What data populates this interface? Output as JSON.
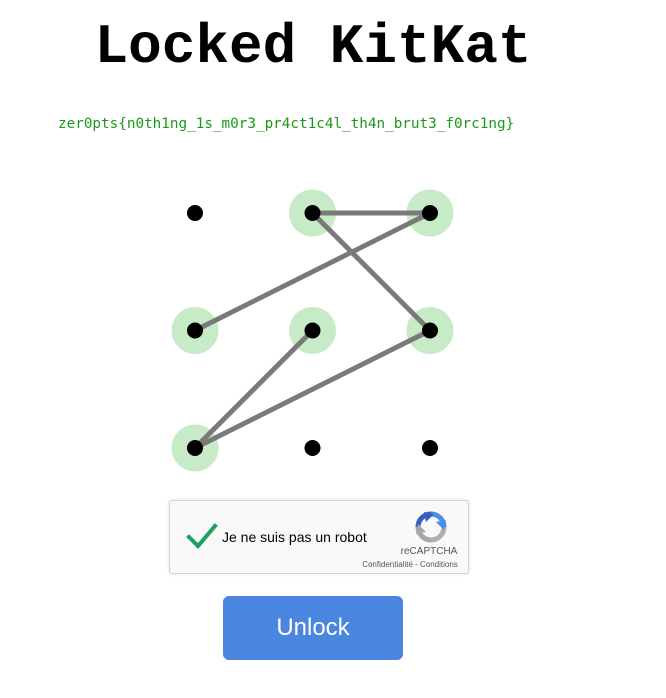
{
  "title": "Locked KitKat",
  "flag": "zer0pts{n0th1ng_1s_m0r3_pr4ct1c4l_th4n_brut3_f0rc1ng}",
  "pattern": {
    "grid": [
      3,
      3
    ],
    "selected": [
      [
        0,
        1
      ],
      [
        0,
        2
      ],
      [
        1,
        0
      ],
      [
        1,
        1
      ],
      [
        1,
        2
      ],
      [
        2,
        0
      ]
    ],
    "sequence": [
      [
        1,
        0
      ],
      [
        0,
        2
      ],
      [
        0,
        1
      ],
      [
        1,
        2
      ],
      [
        2,
        0
      ],
      [
        1,
        1
      ]
    ],
    "colors": {
      "dot": "#000000",
      "highlight": "#c6ebc6",
      "line": "#7a7a7a"
    }
  },
  "captcha": {
    "label": "Je ne suis pas un robot",
    "brand": "reCAPTCHA",
    "links": "Confidentialité - Conditions",
    "checked": true,
    "check_color": "#1aa260"
  },
  "unlock_button": {
    "label": "Unlock",
    "color": "#4a86e0"
  }
}
